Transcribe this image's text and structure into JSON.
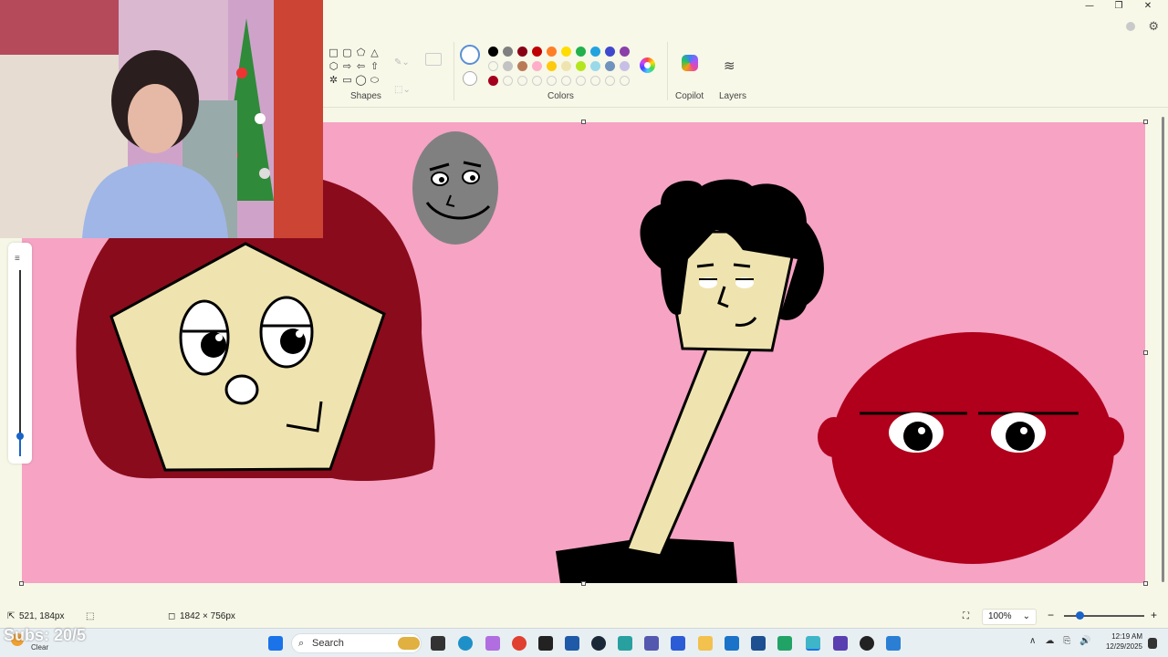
{
  "window": {
    "minimize_glyph": "—",
    "restore_glyph": "❐",
    "close_glyph": "✕",
    "settings_glyph": "⚙"
  },
  "ribbon": {
    "shapes_label": "Shapes",
    "colors_label": "Colors",
    "copilot_label": "Copilot",
    "layers_label": "Layers",
    "shape_glyphs": [
      "□",
      "▢",
      "⬠",
      "△",
      "⬡",
      "⇨",
      "⇦",
      "⇧",
      "✲",
      "▭",
      "◯",
      "⬭"
    ],
    "layers_glyph": "≋",
    "palette": [
      "#000000",
      "#7f7f7f",
      "#880015",
      "#c00000",
      "#ff7f27",
      "#ffdd00",
      "#22b14c",
      "#22a3e0",
      "#3f48cc",
      "#8b3fa8",
      "",
      "#c3c3c3",
      "#b97a57",
      "#ffaec9",
      "#ffc90e",
      "#efe4b0",
      "#b5e61d",
      "#99d9ea",
      "#7092be",
      "#c8bfe7",
      "#a4001d",
      "",
      "",
      "",
      "",
      "",
      "",
      "",
      "",
      ""
    ],
    "primary_color": "#ffffff",
    "secondary_color": "#ffffff"
  },
  "canvas": {
    "background": "#f6a3c4"
  },
  "status": {
    "cursor_pos": "521, 184px",
    "canvas_size": "1842 × 756px",
    "zoom": "100%",
    "zoom_level": 0.2,
    "cursor_glyph": "⇱",
    "selection_glyph": "⬚",
    "size_glyph": "◻",
    "fit_glyph": "⛶",
    "zoom_out_glyph": "−",
    "zoom_in_glyph": "+",
    "dropdown_glyph": "⌄"
  },
  "taskbar": {
    "search_placeholder": "Search",
    "search_glyph": "⌕",
    "tray_glyphs": [
      "∧",
      "☁",
      "⎘",
      "🔊"
    ],
    "time": "12:19 AM",
    "date": "12/29/2025"
  },
  "overlay": {
    "subs_text": "Subs: 20/5",
    "weather_text": "Clear"
  }
}
